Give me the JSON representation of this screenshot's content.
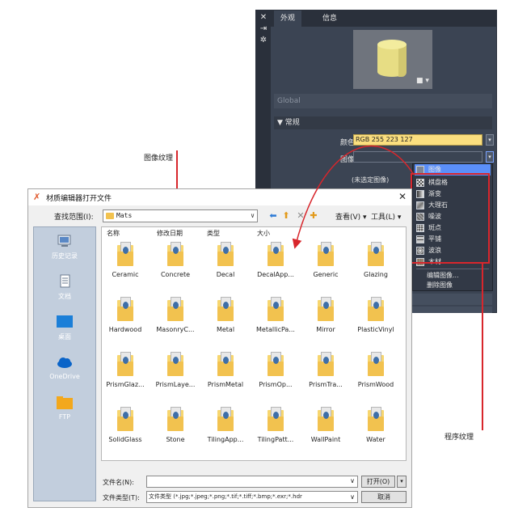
{
  "material_panel": {
    "tabs": [
      "外观",
      "信息"
    ],
    "preview_menu": "▾",
    "global_label": "Global",
    "section_title": "▼ 常规",
    "color_label": "颜色",
    "color_value": "RGB 255 223 127",
    "image_label": "图像",
    "no_image_text": "(未选定图像)",
    "menu_items": [
      "图像",
      "棋盘格",
      "渐变",
      "大理石",
      "噪波",
      "斑点",
      "平铺",
      "波浪",
      "木材"
    ],
    "menu_extra": [
      "编辑图像...",
      "删除图像"
    ],
    "accent_color": "#5b8ff9"
  },
  "annotations": {
    "image_texture": "图像纹理",
    "procedural_texture": "程序纹理",
    "color": "#d8262c"
  },
  "dialog": {
    "title": "材质编辑器打开文件",
    "look_in_label": "查找范围(I):",
    "look_in_value": "Mats",
    "view_label": "查看(V) ▾",
    "tools_label": "工具(L) ▾",
    "columns": [
      "名称",
      "修改日期",
      "类型",
      "大小"
    ],
    "places": [
      "历史记录",
      "文档",
      "桌面",
      "OneDrive",
      "FTP"
    ],
    "files": [
      "Ceramic",
      "Concrete",
      "Decal",
      "DecalApp...",
      "Generic",
      "Glazing",
      "Hardwood",
      "MasonryC...",
      "Metal",
      "MetallicPa...",
      "Mirror",
      "PlasticVinyl",
      "PrismGlaz...",
      "PrismLaye...",
      "PrismMetal",
      "PrismOp...",
      "PrismTra...",
      "PrismWood",
      "SolidGlass",
      "Stone",
      "TilingApp...",
      "TilingPatt...",
      "WallPaint",
      "Water"
    ],
    "file_name_label": "文件名(N):",
    "file_name_value": "",
    "file_type_label": "文件类型(T):",
    "file_type_value": "文件类型 (*.jpg;*.jpeg;*.png;*.tif;*.tiff;*.bmp;*.exr;*.hdr",
    "open_label": "打开(O)",
    "cancel_label": "取消"
  }
}
